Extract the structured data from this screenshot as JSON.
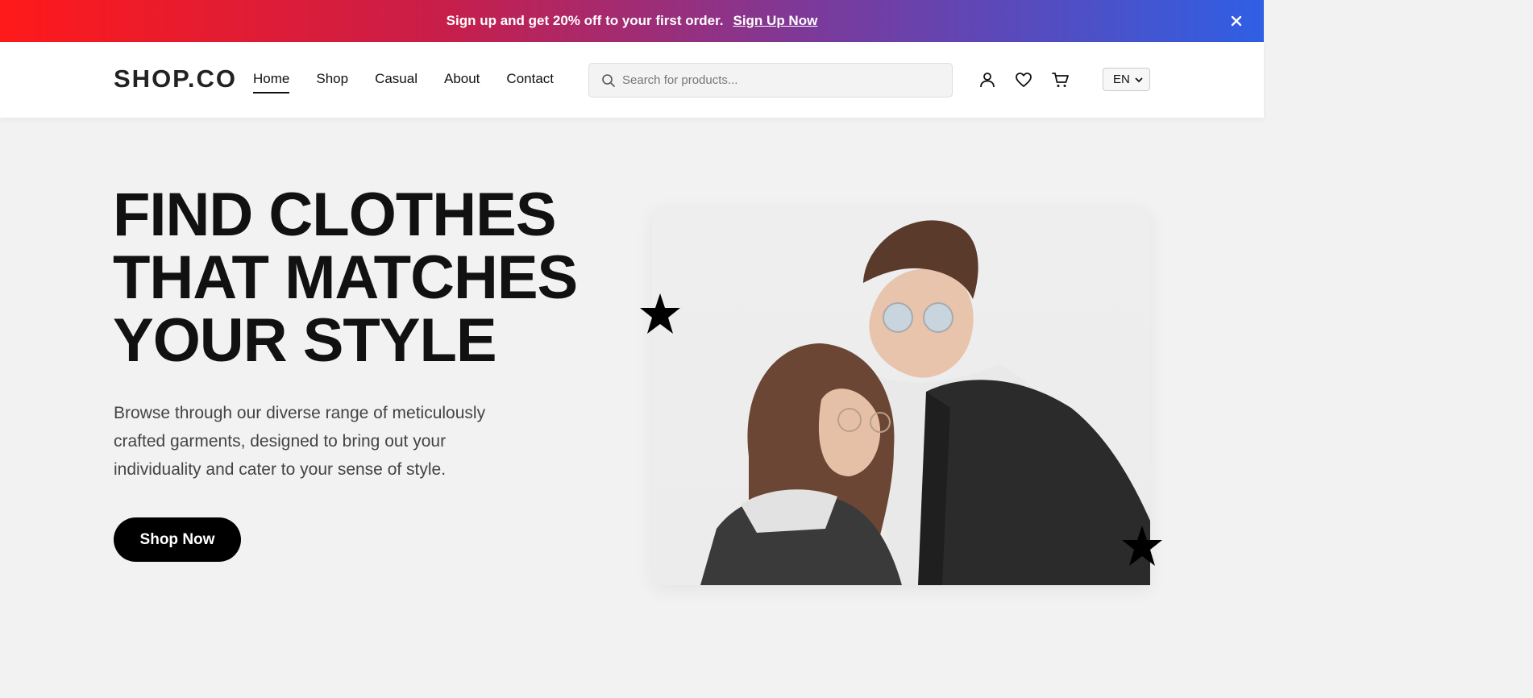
{
  "promo": {
    "text": "Sign up and get 20% off to your first order.",
    "link": "Sign Up Now",
    "gradient": [
      "#ff1a1a",
      "#c81e4a",
      "#7a3a9c",
      "#2f5fe4"
    ]
  },
  "header": {
    "logo": "SHOP.CO",
    "nav": [
      {
        "label": "Home",
        "active": true
      },
      {
        "label": "Shop",
        "active": false
      },
      {
        "label": "Casual",
        "active": false
      },
      {
        "label": "About",
        "active": false
      },
      {
        "label": "Contact",
        "active": false
      }
    ],
    "search_placeholder": "Search for products...",
    "icons": [
      "user-icon",
      "heart-icon",
      "cart-icon"
    ],
    "language": "EN"
  },
  "hero": {
    "title_lines": [
      "FIND CLOTHES",
      "THAT MATCHES",
      "YOUR STYLE"
    ],
    "description": "Browse through our diverse range of meticulously crafted garments, designed to bring out your individuality and cater to your sense of style.",
    "cta": "Shop Now"
  }
}
